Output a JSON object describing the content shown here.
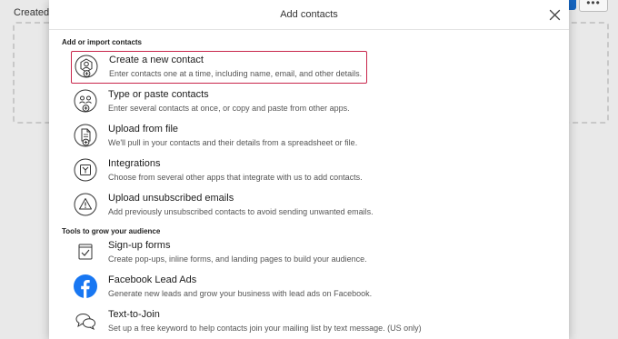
{
  "background": {
    "created_label": "Created: F",
    "more_label": "•••"
  },
  "modal": {
    "title": "Add contacts",
    "close_icon": "close-icon"
  },
  "sections": [
    {
      "title": "Add or import contacts",
      "items": [
        {
          "label": "Create a new contact",
          "description": "Enter contacts one at a time, including name, email, and other details.",
          "icon": "contact-add-icon",
          "selected": true
        },
        {
          "label": "Type or paste contacts",
          "description": "Enter several contacts at once, or copy and paste from other apps.",
          "icon": "contacts-paste-icon",
          "selected": false
        },
        {
          "label": "Upload from file",
          "description": "We'll pull in your contacts and their details from a spreadsheet or file.",
          "icon": "file-upload-icon",
          "selected": false
        },
        {
          "label": "Integrations",
          "description": "Choose from several other apps that integrate with us to add contacts.",
          "icon": "integrations-icon",
          "selected": false
        },
        {
          "label": "Upload unsubscribed emails",
          "description": "Add previously unsubscribed contacts to avoid sending unwanted emails.",
          "icon": "warning-icon",
          "selected": false
        }
      ]
    },
    {
      "title": "Tools to grow your audience",
      "items": [
        {
          "label": "Sign-up forms",
          "description": "Create pop-ups, inline forms, and landing pages to build your audience.",
          "icon": "signup-form-icon",
          "selected": false
        },
        {
          "label": "Facebook Lead Ads",
          "description": "Generate new leads and grow your business with lead ads on Facebook.",
          "icon": "facebook-icon",
          "selected": false
        },
        {
          "label": "Text-to-Join",
          "description": "Set up a free keyword to help contacts join your mailing list by text message. (US only)",
          "icon": "chat-bubbles-icon",
          "selected": false
        }
      ]
    }
  ],
  "colors": {
    "selected_border": "#c8264b",
    "facebook_blue": "#1877f2",
    "background_button": "#1565c0"
  }
}
